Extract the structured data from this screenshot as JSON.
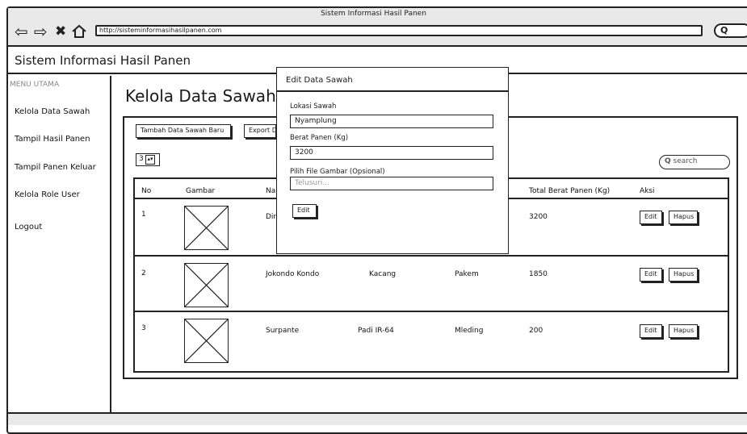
{
  "browser": {
    "window_title": "Sistem Informasi Hasil Panen",
    "url": "http://sisteminformasihasilpanen.com",
    "nav_icons": [
      "back-arrow",
      "forward-arrow",
      "close-x",
      "home"
    ],
    "search_glyph": "Q"
  },
  "app": {
    "title": "Sistem Informasi Hasil Panen"
  },
  "sidebar": {
    "heading": "MENU UTAMA",
    "items": [
      {
        "label": "Kelola Data Sawah"
      },
      {
        "label": "Tampil Hasil Panen"
      },
      {
        "label": "Tampil Panen Keluar"
      },
      {
        "label": "Kelola Role User"
      },
      {
        "label": "Logout"
      }
    ]
  },
  "main": {
    "page_title": "Kelola Data Sawah",
    "add_button": "Tambah Data Sawah Baru",
    "export_button": "Export D",
    "page_size": "3",
    "search_placeholder": "search",
    "table": {
      "headers": [
        "No",
        "Gambar",
        "Na",
        "",
        "",
        "Total Berat Panen (Kg)",
        "Aksi"
      ],
      "rows": [
        {
          "no": "1",
          "nama": "Dir",
          "jenis": "",
          "lokasi": "",
          "total": "3200",
          "edit": "Edit",
          "hapus": "Hapus"
        },
        {
          "no": "2",
          "nama": "Jokondo Kondo",
          "jenis": "Kacang",
          "lokasi": "Pakem",
          "total": "1850",
          "edit": "Edit",
          "hapus": "Hapus"
        },
        {
          "no": "3",
          "nama": "Surpante",
          "jenis": "Padi IR-64",
          "lokasi": "Mleding",
          "total": "200",
          "edit": "Edit",
          "hapus": "Hapus"
        }
      ]
    }
  },
  "modal": {
    "title": "Edit Data Sawah",
    "lokasi_label": "Lokasi Sawah",
    "lokasi_value": "Nyamplung",
    "berat_label": "Berat Panen (Kg)",
    "berat_value": "3200",
    "file_label": "Pilih File Gambar (Opsional)",
    "file_placeholder": "Telusuri...",
    "submit": "Edit"
  }
}
